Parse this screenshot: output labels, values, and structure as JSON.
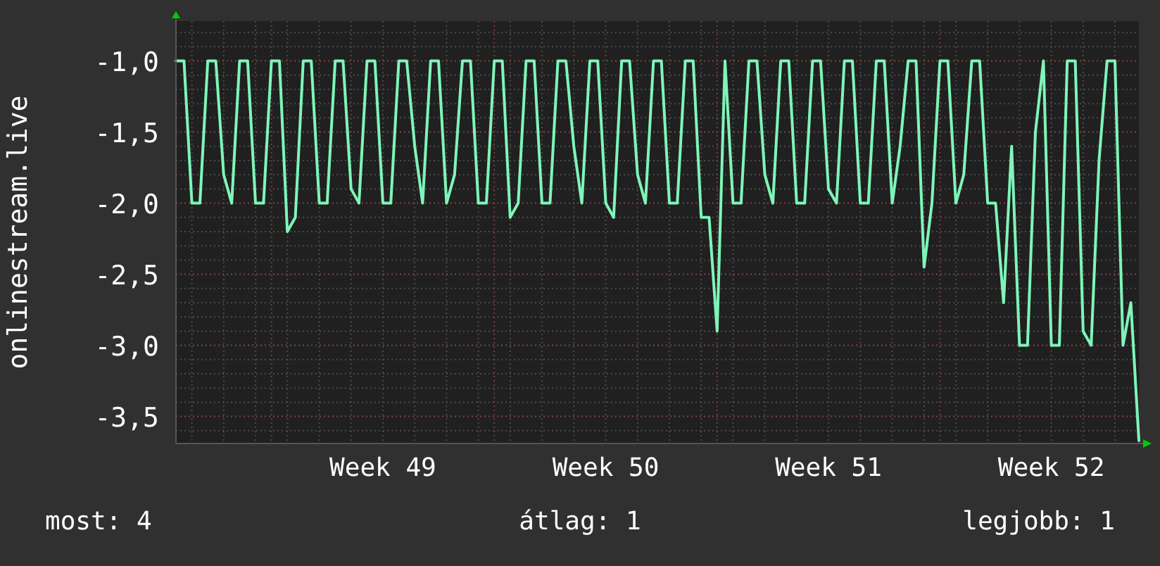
{
  "chart_data": {
    "type": "line",
    "grid": true,
    "ylabel": "onlinestream.live",
    "ylim": [
      -3.69,
      -0.72
    ],
    "yticks": [
      {
        "value": -1.0,
        "label": "-1,0"
      },
      {
        "value": -1.5,
        "label": "-1,5"
      },
      {
        "value": -2.0,
        "label": "-2,0"
      },
      {
        "value": -2.5,
        "label": "-2,5"
      },
      {
        "value": -3.0,
        "label": "-3,0"
      },
      {
        "value": -3.5,
        "label": "-3,5"
      }
    ],
    "categories": [
      null,
      null,
      null,
      null,
      null,
      null,
      null,
      null,
      null,
      null,
      null,
      null,
      null,
      null,
      null,
      null,
      null,
      null,
      null,
      null,
      null,
      null,
      null,
      null,
      null,
      null,
      "Week 49",
      null,
      null,
      null,
      null,
      null,
      null,
      null,
      null,
      null,
      null,
      null,
      null,
      null,
      null,
      null,
      null,
      null,
      null,
      null,
      null,
      null,
      null,
      null,
      null,
      null,
      null,
      null,
      "Week 50",
      null,
      null,
      null,
      null,
      null,
      null,
      null,
      null,
      null,
      null,
      null,
      null,
      null,
      null,
      null,
      null,
      null,
      null,
      null,
      null,
      null,
      null,
      null,
      null,
      null,
      null,
      null,
      "Week 51",
      null,
      null,
      null,
      null,
      null,
      null,
      null,
      null,
      null,
      null,
      null,
      null,
      null,
      null,
      null,
      null,
      null,
      null,
      null,
      null,
      null,
      null,
      null,
      null,
      null,
      null,
      null,
      "Week 52",
      null,
      null,
      null,
      null,
      null,
      null,
      null,
      null,
      null,
      null,
      null
    ],
    "series": [
      {
        "color": "#7ef5b8",
        "values": [
          -1,
          -1,
          -2,
          -2,
          -1,
          -1,
          -1.8,
          -2,
          -1,
          -1,
          -2,
          -2,
          -1,
          -1,
          -2.2,
          -2.1,
          -1,
          -1,
          -2,
          -2,
          -1,
          -1,
          -1.9,
          -2,
          -1,
          -1,
          -2,
          -2,
          -1,
          -1,
          -1.6,
          -2,
          -1,
          -1,
          -2,
          -1.8,
          -1,
          -1,
          -2,
          -2,
          -1,
          -1,
          -2.1,
          -2,
          -1,
          -1,
          -2,
          -2,
          -1,
          -1,
          -1.6,
          -2,
          -1,
          -1,
          -2,
          -2.1,
          -1,
          -1,
          -1.8,
          -2,
          -1,
          -1,
          -2,
          -2,
          -1,
          -1,
          -2.1,
          -2.1,
          -2.9,
          -1,
          -2,
          -2,
          -1,
          -1,
          -1.8,
          -2,
          -1,
          -1,
          -2,
          -2,
          -1,
          -1,
          -1.9,
          -2,
          -1,
          -1,
          -2,
          -2,
          -1,
          -1,
          -2,
          -1.6,
          -1,
          -1,
          -2.45,
          -2,
          -1,
          -1,
          -2,
          -1.8,
          -1,
          -1,
          -2,
          -2,
          -2.7,
          -1.6,
          -3,
          -3,
          -1.5,
          -1,
          -3,
          -3,
          -1,
          -1,
          -2.9,
          -3,
          -1.7,
          -1,
          -1,
          -3,
          -2.7,
          -3.67
        ]
      }
    ]
  },
  "footer": [
    {
      "kind": "current",
      "text": "most: 4"
    },
    {
      "kind": "average",
      "text": "átlag: 1"
    },
    {
      "kind": "best",
      "text": "legjobb: 1"
    }
  ]
}
